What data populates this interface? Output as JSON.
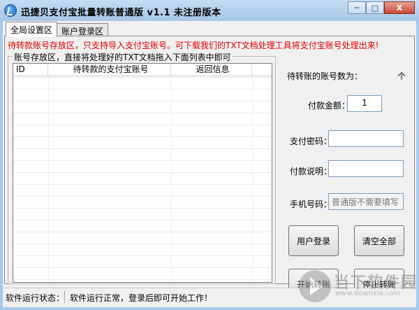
{
  "window": {
    "title": "迅捷贝支付宝批量转账普通版   v1.1   未注册版本",
    "minimize": "─",
    "maximize": "□",
    "close": "X"
  },
  "tabs": [
    {
      "label": "全局设置区",
      "active": true
    },
    {
      "label": "账户登录区",
      "active": false
    }
  ],
  "warning": "待转款账号存放区，只支持导入支付宝账号。可下载我们的TXT文档处理工具将支付宝账号处理出来!",
  "groupbox": {
    "title": "账号存放区，直接将处理好的TXT文档拖入下面列表中即可"
  },
  "table": {
    "columns": [
      "ID",
      "待转款的支付宝账号",
      "返回信息",
      ""
    ],
    "rows": []
  },
  "right": {
    "count_label": "待转账的账号数为：",
    "count_unit": "个",
    "amount_label": "付款金额：",
    "amount_value": "1",
    "password_label": "支付密码：",
    "password_value": "",
    "note_label": "付款说明：",
    "note_value": "",
    "phone_label": "手机号码：",
    "phone_placeholder": "普通版不需要填写"
  },
  "buttons": {
    "login": "用户登录",
    "clear_all": "清空全部",
    "start": "开始转账",
    "stop": "停止转账"
  },
  "status": {
    "label": "软件运行状态：",
    "text": "软件运行正常，登录后即可开始工作！"
  },
  "watermark": {
    "line1": "当下软件园",
    "line2": "www.downxia.com"
  },
  "colors": {
    "warning": "#e00000",
    "titlebar": "#a6c6e8"
  }
}
